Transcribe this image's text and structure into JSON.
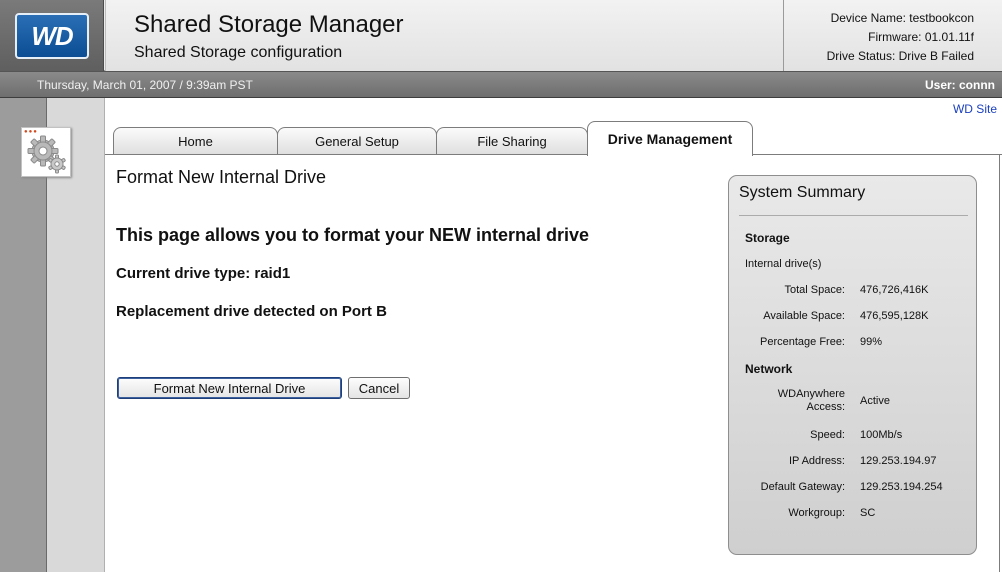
{
  "header": {
    "logo_text": "WD",
    "title": "Shared Storage Manager",
    "subtitle": "Shared Storage configuration",
    "device_name": "Device Name: testbookcon",
    "firmware": "Firmware: 01.01.11f",
    "drive_status": "Drive Status: Drive B Failed"
  },
  "status_bar": {
    "datetime": "Thursday, March 01, 2007 / 9:39am PST",
    "user": "User: connn"
  },
  "links": {
    "wd_site": "WD Site"
  },
  "tabs": [
    {
      "label": "Home",
      "active": false
    },
    {
      "label": "General Setup",
      "active": false
    },
    {
      "label": "File Sharing",
      "active": false
    },
    {
      "label": "Drive Management",
      "active": true
    }
  ],
  "main": {
    "heading": "Format New Internal Drive",
    "intro": "This page allows you to format your NEW internal drive",
    "drive_type": "Current drive type: raid1",
    "replacement": "Replacement drive detected on Port B",
    "format_button": "Format New Internal Drive",
    "cancel_button": "Cancel"
  },
  "summary": {
    "title": "System Summary",
    "storage_label": "Storage",
    "internal_drives": "Internal drive(s)",
    "storage_rows": [
      {
        "label": "Total Space:",
        "value": "476,726,416K"
      },
      {
        "label": "Available Space:",
        "value": "476,595,128K"
      },
      {
        "label": "Percentage Free:",
        "value": "99%"
      }
    ],
    "network_label": "Network",
    "wdanywhere_label_1": "WDAnywhere",
    "wdanywhere_label_2": "Access:",
    "wdanywhere_value": "Active",
    "network_rows": [
      {
        "label": "Speed:",
        "value": "100Mb/s"
      },
      {
        "label": "IP Address:",
        "value": "129.253.194.97"
      },
      {
        "label": "Default Gateway:",
        "value": "129.253.194.254"
      },
      {
        "label": "Workgroup:",
        "value": "SC"
      }
    ]
  },
  "colors": {
    "logo_blue": "#0c4d93",
    "link_blue": "#1a3fbf",
    "status_bar_gray": "#7c7c7c"
  },
  "icons": {
    "logo": "wd-logo",
    "settings": "gear-icon"
  }
}
